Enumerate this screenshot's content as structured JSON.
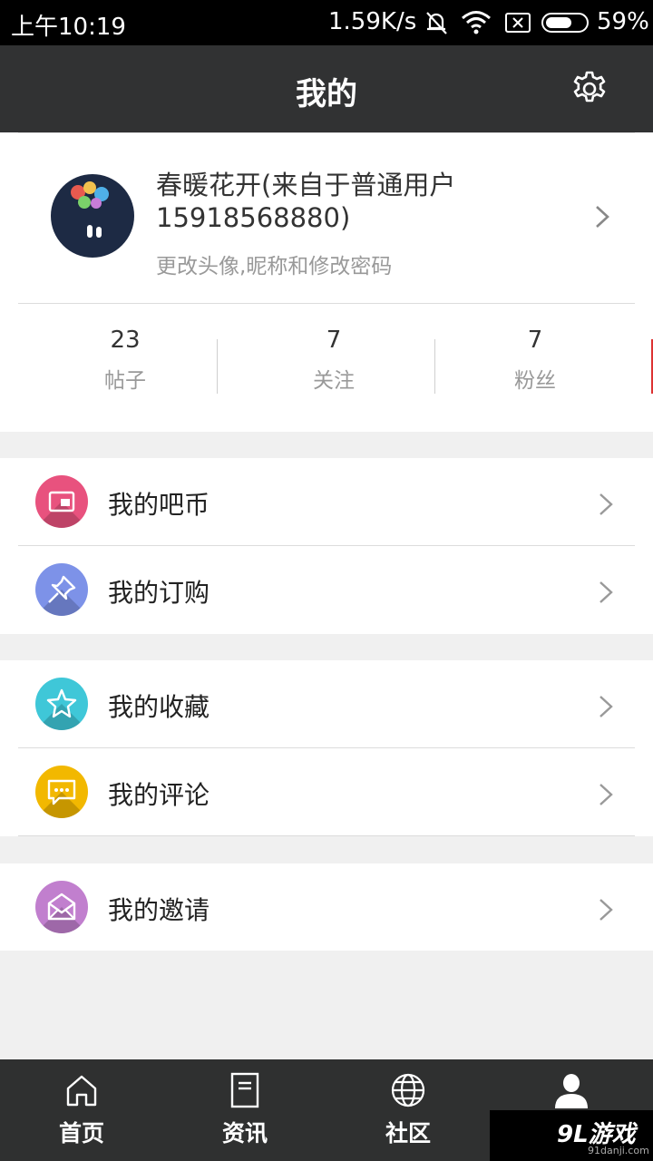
{
  "status_bar": {
    "time": "上午10:19",
    "speed": "1.59K/s",
    "battery": "59%"
  },
  "header": {
    "title": "我的"
  },
  "profile": {
    "name": "春暖花开(来自于普通用户15918568880)",
    "hint": "更改头像,昵称和修改密码",
    "stats": [
      {
        "value": "23",
        "label": "帖子"
      },
      {
        "value": "7",
        "label": "关注"
      },
      {
        "value": "7",
        "label": "粉丝"
      }
    ]
  },
  "menu": [
    {
      "label": "我的吧币",
      "color": "#e8527e",
      "icon": "wallet-icon"
    },
    {
      "label": "我的订购",
      "color": "#7d92e8",
      "icon": "pin-icon"
    },
    {
      "label": "我的收藏",
      "color": "#3fc7d8",
      "icon": "star-icon"
    },
    {
      "label": "我的评论",
      "color": "#f2b800",
      "icon": "comment-icon"
    },
    {
      "label": "我的邀请",
      "color": "#c17fce",
      "icon": "envelope-icon"
    }
  ],
  "bottom_nav": [
    {
      "label": "首页",
      "icon": "home-icon"
    },
    {
      "label": "资讯",
      "icon": "document-icon"
    },
    {
      "label": "社区",
      "icon": "globe-icon"
    },
    {
      "label": "",
      "icon": "person-icon"
    }
  ],
  "watermark": {
    "brand": "9L游戏",
    "url": "91danji.com"
  }
}
